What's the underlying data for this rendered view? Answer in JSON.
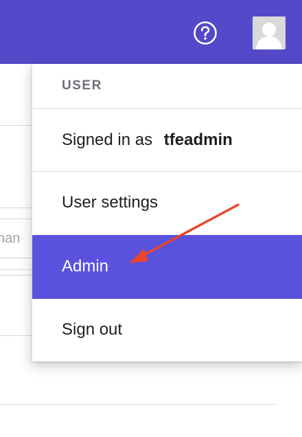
{
  "topbar": {
    "help_icon": "help-circle-icon",
    "avatar_icon": "user-avatar-icon",
    "color": "#5449c8"
  },
  "background": {
    "input_fragment_text": "nan"
  },
  "user_menu": {
    "header": "USER",
    "signed_in_prefix": "Signed in as",
    "username": "tfeadmin",
    "items": [
      {
        "label": "User settings",
        "active": false
      },
      {
        "label": "Admin",
        "active": true
      },
      {
        "label": "Sign out",
        "active": false
      }
    ],
    "active_color": "#5a52dc"
  },
  "annotation": {
    "arrow_color": "#e8452c",
    "points_to": "Admin"
  }
}
